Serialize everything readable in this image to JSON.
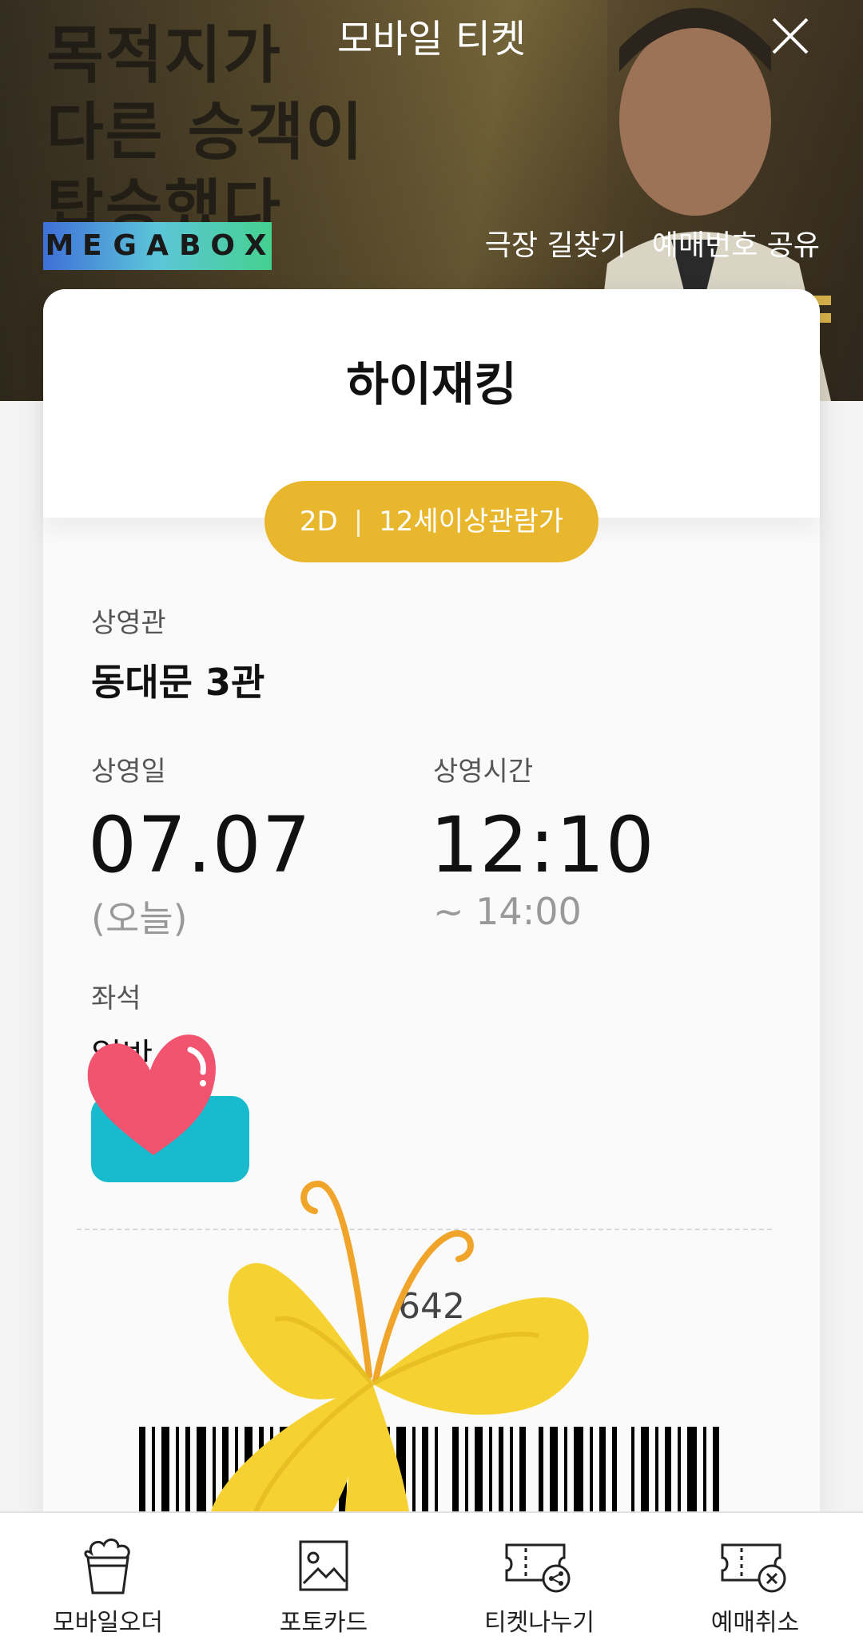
{
  "header": {
    "title": "모바일 티켓",
    "close_icon": "close-icon",
    "poster_text": [
      "목적지가",
      "다른 승객이",
      "탑승했다"
    ],
    "brand_letters": [
      "M",
      "E",
      "G",
      "A",
      "B",
      "O",
      "X"
    ],
    "links": [
      "극장 길찾기",
      "예매번호 공유"
    ]
  },
  "ticket": {
    "movie_title": "하이재킹",
    "format": "2D",
    "rating": "12세이상관람가",
    "badge_color": "#e8b72d",
    "theater_label": "상영관",
    "theater": "동대문 3관",
    "date_label": "상영일",
    "date": "07.07",
    "date_note": "(오늘)",
    "time_label": "상영시간",
    "start_time": "12:10",
    "end_time": "~  14:00",
    "seat_label": "좌석",
    "seat": "일반",
    "booking_partial": "642"
  },
  "stickers": {
    "heart_color": "#f25470",
    "block_color": "#17bbcd",
    "butterfly_color": "#f5d232"
  },
  "bottom_nav": [
    {
      "label": "모바일오더",
      "icon": "popcorn-icon"
    },
    {
      "label": "포토카드",
      "icon": "image-icon"
    },
    {
      "label": "티켓나누기",
      "icon": "ticket-share-icon"
    },
    {
      "label": "예매취소",
      "icon": "ticket-cancel-icon"
    }
  ]
}
